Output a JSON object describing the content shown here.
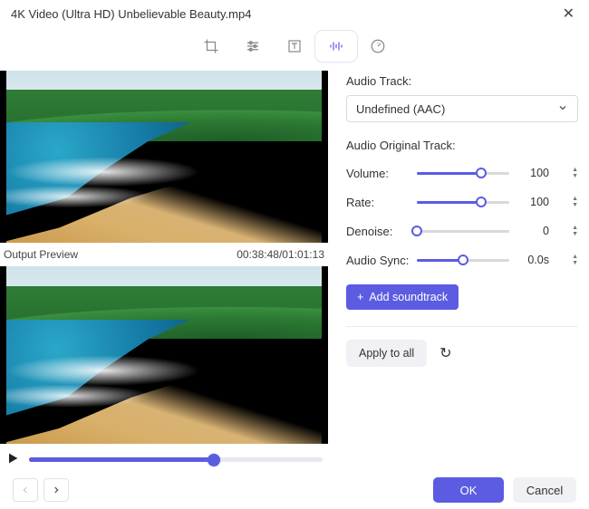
{
  "window": {
    "title": "4K Video (Ultra HD) Unbelievable Beauty.mp4"
  },
  "preview": {
    "output_label": "Output Preview",
    "timecode": "00:38:48/01:01:13"
  },
  "audio": {
    "track_label": "Audio Track:",
    "track_selected": "Undefined (AAC)",
    "original_label": "Audio Original Track:",
    "rows": {
      "volume": {
        "label": "Volume:",
        "value": "100",
        "pct": 70
      },
      "rate": {
        "label": "Rate:",
        "value": "100",
        "pct": 70
      },
      "denoise": {
        "label": "Denoise:",
        "value": "0",
        "pct": 0
      },
      "audiosync": {
        "label": "Audio Sync:",
        "value": "0.0s",
        "pct": 50
      }
    },
    "add_soundtrack_label": "Add soundtrack"
  },
  "actions": {
    "apply_label": "Apply to all",
    "ok_label": "OK",
    "cancel_label": "Cancel"
  },
  "transport": {
    "progress_pct": 63
  }
}
